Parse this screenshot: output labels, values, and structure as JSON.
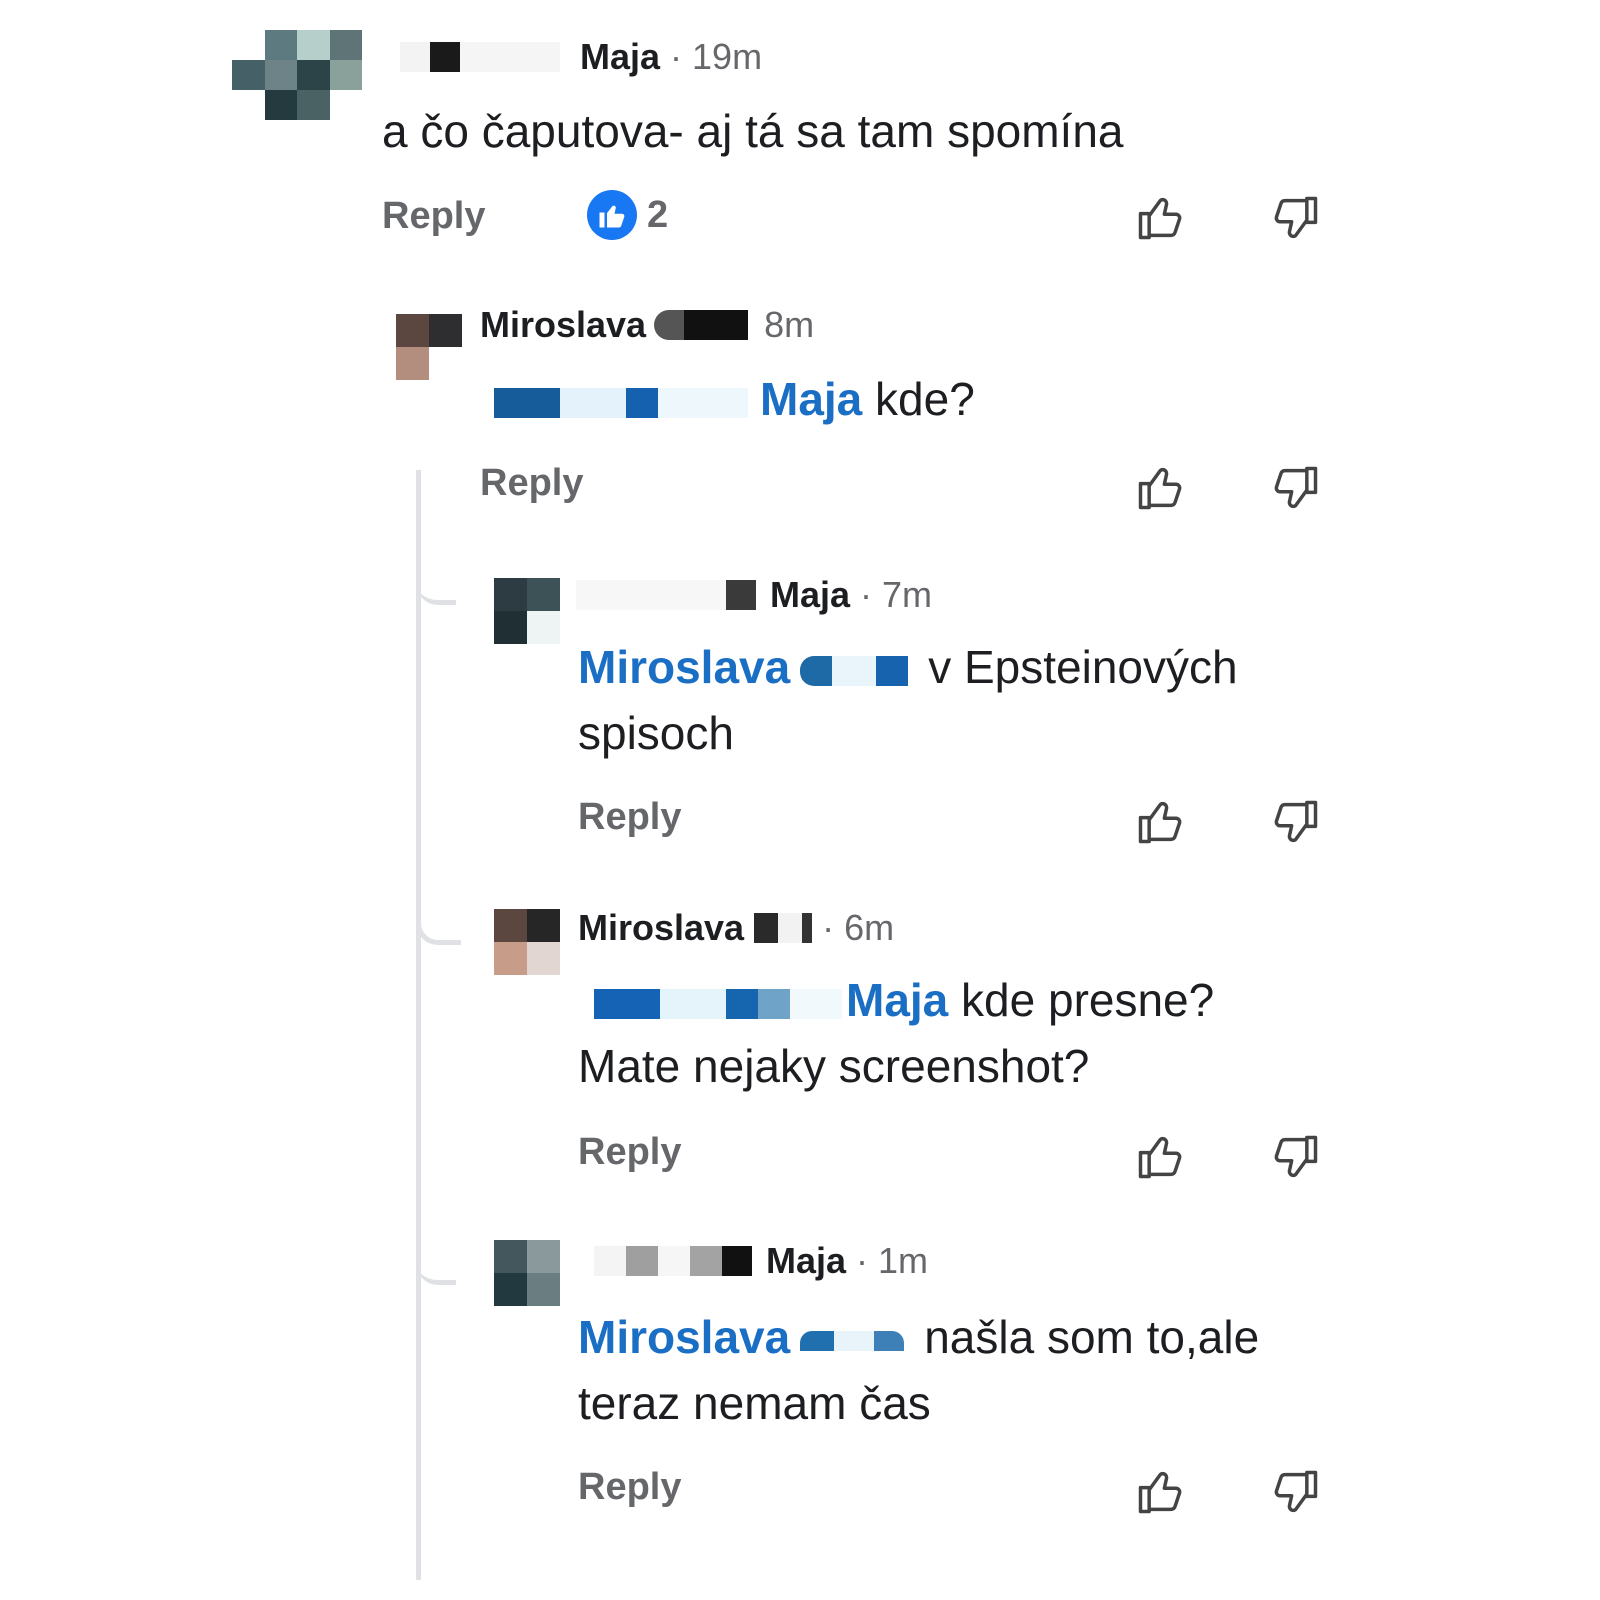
{
  "comments": [
    {
      "author": "Maja",
      "time": "· 19m",
      "text": "a čo čaputova- aj tá sa tam spomína",
      "reply_label": "Reply",
      "reactions": {
        "icon": "like-reaction-icon",
        "count": "2"
      }
    },
    {
      "author": "Miroslava",
      "time": "8m",
      "mention": "Maja",
      "text": " kde?",
      "reply_label": "Reply"
    },
    {
      "author": "Maja",
      "time": "· 7m",
      "mention": "Miroslava",
      "text_line1": "v Epsteinových",
      "text_line2": "spisoch",
      "reply_label": "Reply"
    },
    {
      "author": "Miroslava",
      "time": "· 6m",
      "mention": "Maja",
      "text_line1": " kde presne?",
      "text_line2": "Mate nejaky screenshot?",
      "reply_label": "Reply"
    },
    {
      "author": "Maja",
      "time": "· 1m",
      "mention": "Miroslava",
      "text_line1": "našla som to,ale",
      "text_line2": "teraz nemam čas",
      "reply_label": "Reply"
    }
  ],
  "icons": {
    "like": "thumbs-up-outline-icon",
    "dislike": "thumbs-down-outline-icon"
  },
  "colors": {
    "mention": "#1a6fc4",
    "reaction": "#1877f2",
    "muted": "#65676b"
  }
}
